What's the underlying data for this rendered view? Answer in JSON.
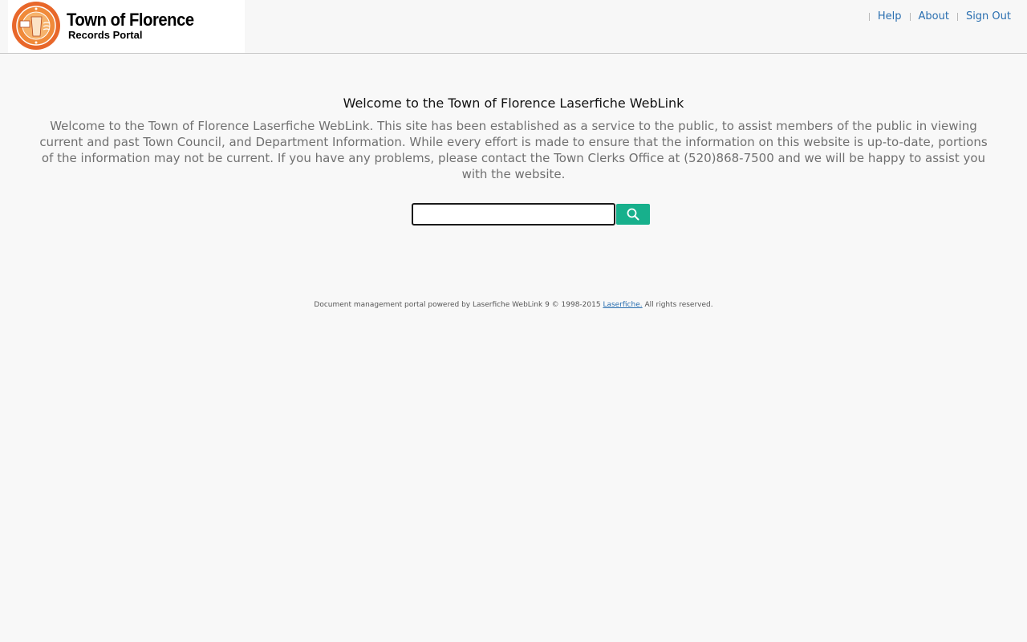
{
  "header": {
    "brand_title": "Town of Florence",
    "brand_subtitle": "Records Portal",
    "nav": {
      "help": "Help",
      "about": "About",
      "sign_out": "Sign Out"
    }
  },
  "main": {
    "title": "Welcome to the Town of Florence Laserfiche WebLink",
    "description": "Welcome to the Town of Florence Laserfiche WebLink. This site has been established as a service to the public, to assist members of the public in viewing current and past Town Council, and Department Information. While every effort is made to ensure that the information on this website is up-to-date, portions of the information may not be current. If you have any problems, please contact the Town Clerks Office at (520)868-7500 and we will be happy to assist you with the website.",
    "search": {
      "value": "",
      "button_icon": "search-icon"
    }
  },
  "footer": {
    "text_before": "Document management portal powered by Laserfiche WebLink 9 © 1998-2015 ",
    "link": "Laserfiche.",
    "text_after": " All rights reserved."
  },
  "colors": {
    "accent": "#17b08c",
    "link": "#2a6fb0",
    "seal": "#e8672a"
  }
}
